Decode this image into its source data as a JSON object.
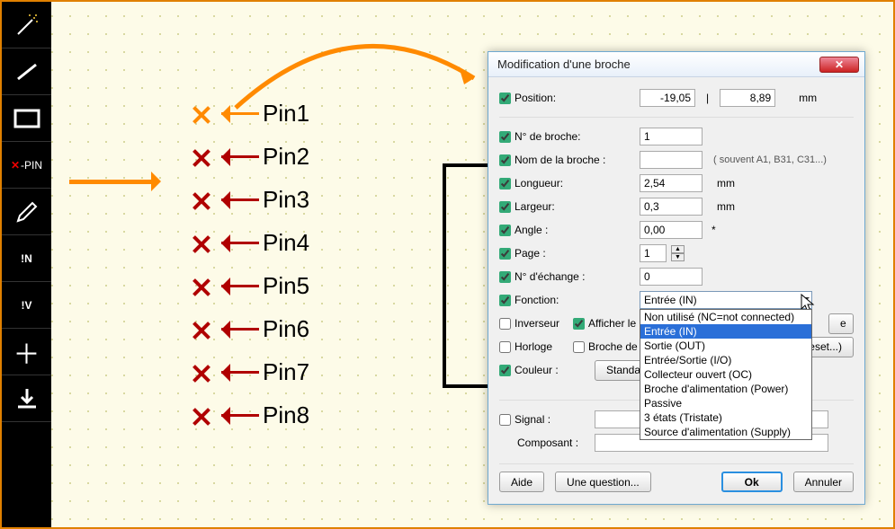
{
  "toolbar": {
    "pin_label": "PIN",
    "in_label": "!N",
    "iv_label": "!V"
  },
  "pins": [
    {
      "label": "Pin1"
    },
    {
      "label": "Pin2"
    },
    {
      "label": "Pin3"
    },
    {
      "label": "Pin4"
    },
    {
      "label": "Pin5"
    },
    {
      "label": "Pin6"
    },
    {
      "label": "Pin7"
    },
    {
      "label": "Pin8"
    }
  ],
  "dialog": {
    "title": "Modification d'une broche",
    "position": {
      "label": "Position:",
      "x": "-19,05",
      "sep": "|",
      "y": "8,89",
      "unit": "mm"
    },
    "pin_number": {
      "label": "N° de broche:",
      "value": "1"
    },
    "pin_name": {
      "label": "Nom de la broche :",
      "value": "",
      "hint": "( souvent A1, B31, C31...)"
    },
    "length": {
      "label": "Longueur:",
      "value": "2,54",
      "unit": "mm"
    },
    "width": {
      "label": "Largeur:",
      "value": "0,3",
      "unit": "mm"
    },
    "angle": {
      "label": "Angle :",
      "value": "0,00",
      "unit": "*"
    },
    "page": {
      "label": "Page :",
      "value": "1"
    },
    "exchange": {
      "label": "N° d'échange :",
      "value": "0"
    },
    "function": {
      "label": "Fonction:",
      "selected": "Entrée (IN)",
      "options": [
        "Non utilisé (NC=not connected)",
        "Entrée (IN)",
        "Sortie (OUT)",
        "Entrée/Sortie (I/O)",
        "Collecteur ouvert (OC)",
        "Broche d'alimentation (Power)",
        "Passive",
        "3 états (Tristate)",
        "Source d'alimentation (Supply)"
      ]
    },
    "inverter": "Inverseur",
    "show_num": "Afficher le num",
    "clock": "Horloge",
    "ref_pin": "Broche de réf",
    "color": {
      "label": "Couleur :",
      "btn": "Standard"
    },
    "hidden_btn": "e",
    "reset_btn": "Reset...)",
    "signal": "Signal :",
    "component": "Composant :",
    "help": "Aide",
    "question": "Une question...",
    "ok": "Ok",
    "cancel": "Annuler"
  }
}
